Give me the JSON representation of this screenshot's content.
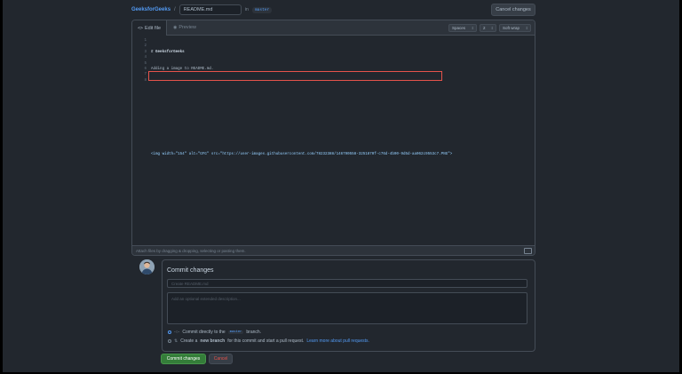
{
  "header": {
    "repo": "GeeksforGeeks",
    "separator": "/",
    "filename": "README.md",
    "in_label": "in",
    "branch": "master",
    "cancel_label": "Cancel changes"
  },
  "editor": {
    "tab_edit": "Edit file",
    "tab_preview": "Preview",
    "indent_mode": "Spaces",
    "indent_size": "2",
    "wrap_mode": "Soft wrap",
    "line_numbers": [
      "1",
      "2",
      "3",
      "4",
      "5",
      "6",
      "7",
      "8"
    ],
    "lines": [
      "# GeeksforGeeks",
      "Adding a image to README.md.",
      "",
      "",
      "",
      "",
      "<img width=\"154\" alt=\"GFG\" src=\"https://user-images.githubusercontent.com/78232388/146790558-3251870f-c76d-4b90-9d5d-aa062c9553c7.PNG\">",
      ""
    ],
    "attach_hint": "Attach files by dragging & dropping, selecting or pasting them."
  },
  "commit": {
    "title": "Commit changes",
    "summary_placeholder": "Create README.md",
    "description_placeholder": "Add an optional extended description...",
    "option_direct_pre": "Commit directly to the",
    "option_direct_branch": "master",
    "option_direct_post": "branch.",
    "option_new_pre": "Create a",
    "option_new_bold": "new branch",
    "option_new_post": "for this commit and start a pull request.",
    "option_new_link": "Learn more about pull requests.",
    "commit_button": "Commit changes",
    "cancel_button": "Cancel"
  },
  "colors": {
    "accent": "#539bf5",
    "primary_button": "#347d39",
    "danger": "#e5534b",
    "highlight_box": "#e5534b"
  }
}
